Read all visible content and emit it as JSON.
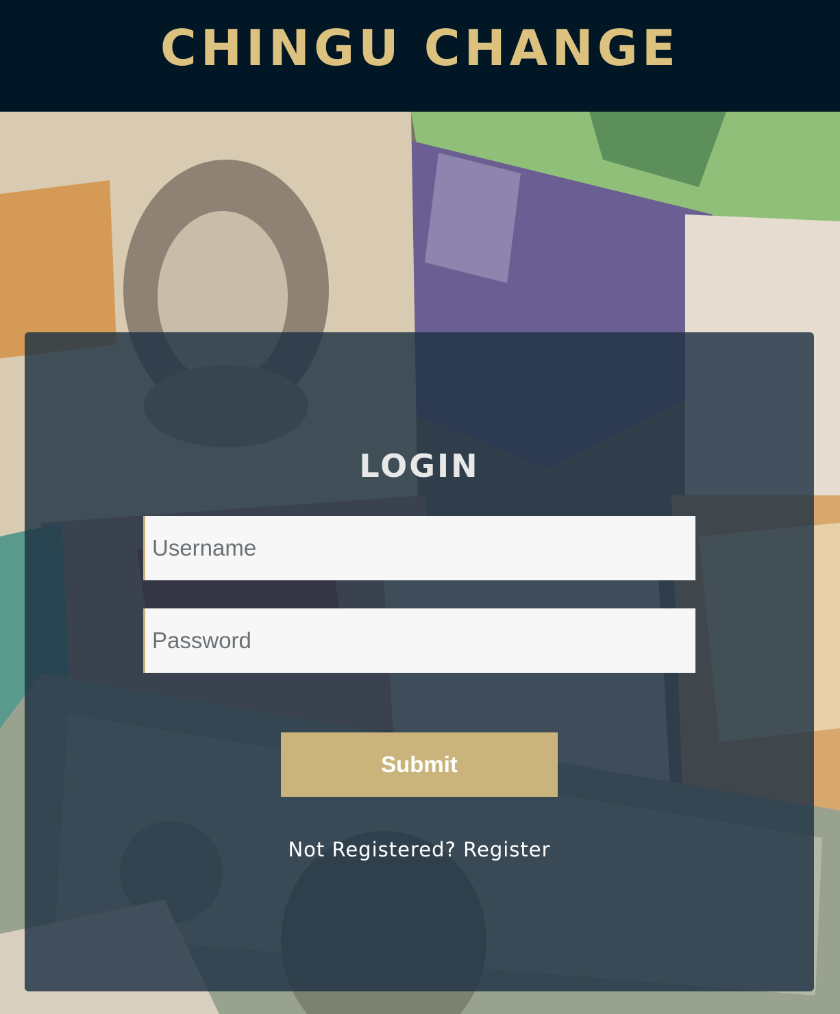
{
  "header": {
    "brand": "CHINGU CHANGE"
  },
  "colors": {
    "header_bg": "#011726",
    "brand_gold": "#dcc27e",
    "panel_overlay": "#1e3244",
    "submit_bg": "#cab47c",
    "input_bg": "#f7f7f7"
  },
  "login": {
    "title": "LOGIN",
    "username_placeholder": "Username",
    "password_placeholder": "Password",
    "submit_label": "Submit",
    "not_registered_text": "Not Registered?",
    "register_link": "Register"
  }
}
